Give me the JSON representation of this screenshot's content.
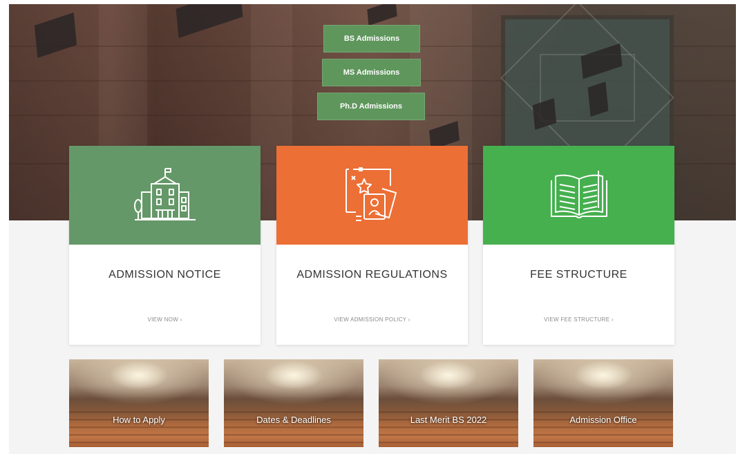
{
  "hero": {
    "buttons": [
      {
        "label": "BS Admissions"
      },
      {
        "label": "MS Admissions"
      },
      {
        "label": "Ph.D Admissions"
      }
    ]
  },
  "cards": [
    {
      "title": "ADMISSION NOTICE",
      "link": "VIEW NOW ›",
      "color": "#659868",
      "icon": "university-building-icon"
    },
    {
      "title": "ADMISSION REGULATIONS",
      "link": "VIEW ADMISSION POLICY ›",
      "color": "#ec6f36",
      "icon": "regulations-id-card-icon"
    },
    {
      "title": "FEE STRUCTURE",
      "link": "VIEW FEE STRUCTURE ›",
      "color": "#46b04f",
      "icon": "open-book-icon"
    }
  ],
  "tiles": [
    {
      "label": "How to Apply"
    },
    {
      "label": "Dates & Deadlines"
    },
    {
      "label": "Last Merit BS 2022"
    },
    {
      "label": "Admission Office"
    }
  ]
}
